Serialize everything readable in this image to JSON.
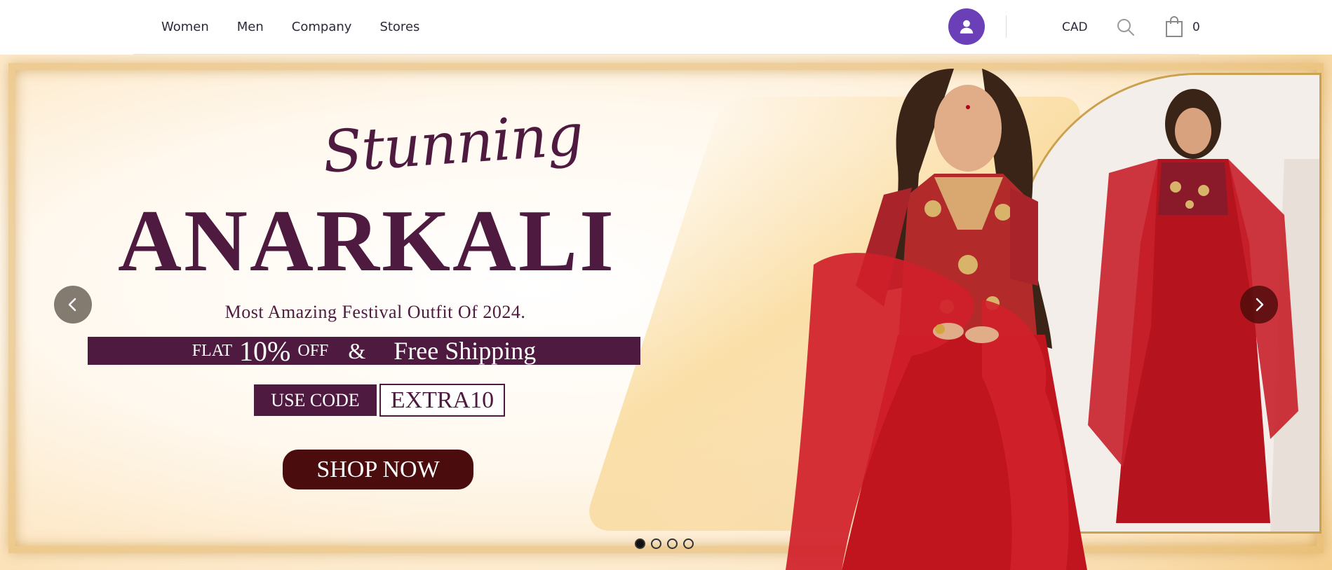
{
  "header": {
    "nav": [
      {
        "label": "Women"
      },
      {
        "label": "Men"
      },
      {
        "label": "Company"
      },
      {
        "label": "Stores"
      }
    ],
    "currency": "CAD",
    "cart_count": "0",
    "icons": [
      "user-icon",
      "search-icon",
      "shopping-bag-icon"
    ],
    "accent_color": "#6b3fb8"
  },
  "hero": {
    "script_title": "Stunning",
    "main_title": "ANARKALI",
    "subtitle": "Most Amazing Festival Outfit Of 2024.",
    "offer": {
      "flat": "FLAT",
      "percent": "10%",
      "off": "OFF",
      "amp": "&",
      "shipping": "Free Shipping"
    },
    "code_label": "USE CODE",
    "code_value": "EXTRA10",
    "cta": "SHOP NOW",
    "slides_total": 4,
    "active_slide": 1,
    "brand_color": "#4f1a3f",
    "cta_color": "#4a0c0c"
  }
}
